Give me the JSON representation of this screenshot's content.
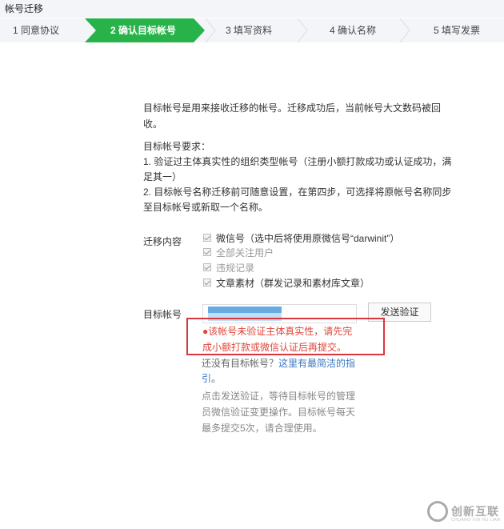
{
  "page": {
    "title": "帐号迁移"
  },
  "steps": [
    {
      "label": "1 同意协议"
    },
    {
      "label": "2 确认目标帐号"
    },
    {
      "label": "3 填写资料"
    },
    {
      "label": "4 确认名称"
    },
    {
      "label": "5 填写发票"
    }
  ],
  "colors": {
    "active_step": "#27b34a",
    "error": "#e0463c",
    "link": "#3a78c3",
    "error_border": "#d9363e"
  },
  "intro": {
    "line1": "目标帐号是用来接收迁移的帐号。迁移成功后，当前帐号大文数码被回",
    "line2": "收。"
  },
  "requirements": {
    "heading": "目标帐号要求：",
    "r1a": "1. 验证过主体真实性的组织类型帐号（注册小额打款成功或认证成功，满",
    "r1b": "足其一）",
    "r2a": "2. 目标帐号名称迁移前可随意设置，在第四步，可选择将原帐号名称同步",
    "r2b": "至目标帐号或新取一个名称。"
  },
  "migration": {
    "label": "迁移内容",
    "items": [
      {
        "text": "微信号（选中后将使用原微信号“darwinit”）",
        "dim": false
      },
      {
        "text": "全部关注用户",
        "dim": true
      },
      {
        "text": "违规记录",
        "dim": true
      },
      {
        "text": "文章素材（群发记录和素材库文章）",
        "dim": false
      }
    ]
  },
  "target": {
    "label": "目标帐号",
    "send_button": "发送验证",
    "error_line1": "●该帐号未验证主体真实性，请先完",
    "error_line2": "成小额打款或微信认证后再提交。",
    "hint_prefix": "还没有目标帐号？",
    "hint_link_line1": "这里有最简洁的指",
    "hint_link_line2": "引",
    "hint_suffix": "。",
    "note_line1": "点击发送验证，等待目标帐号的管理",
    "note_line2": "员微信验证变更操作。目标帐号每天",
    "note_line3": "最多提交5次，请合理使用。"
  },
  "watermark": {
    "text": "创新互联",
    "sub": "CHUANG XIN HU LIAN"
  }
}
